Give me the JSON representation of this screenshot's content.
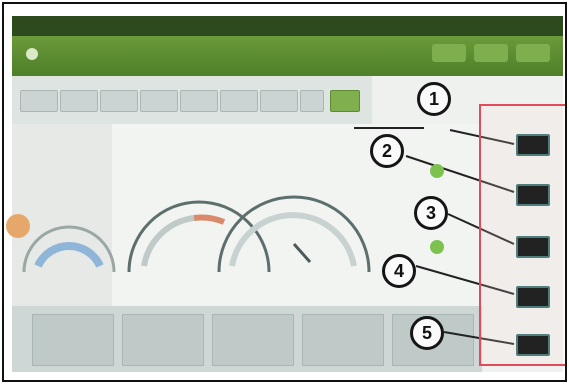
{
  "callouts": [
    "1",
    "2",
    "3",
    "4",
    "5"
  ],
  "sidebar": {
    "buttons": [
      "",
      "",
      "",
      "",
      ""
    ]
  },
  "titlebar": {
    "title": "",
    "buttons": [
      "",
      "",
      ""
    ]
  },
  "colors": {
    "titlebar": "#5a8a2e",
    "highlight_border": "#e24b5a",
    "callout_border": "#151515",
    "side_button": "#222222"
  },
  "icons": {
    "app_logo": "app-logo-icon",
    "status": "check-circle-icon"
  }
}
